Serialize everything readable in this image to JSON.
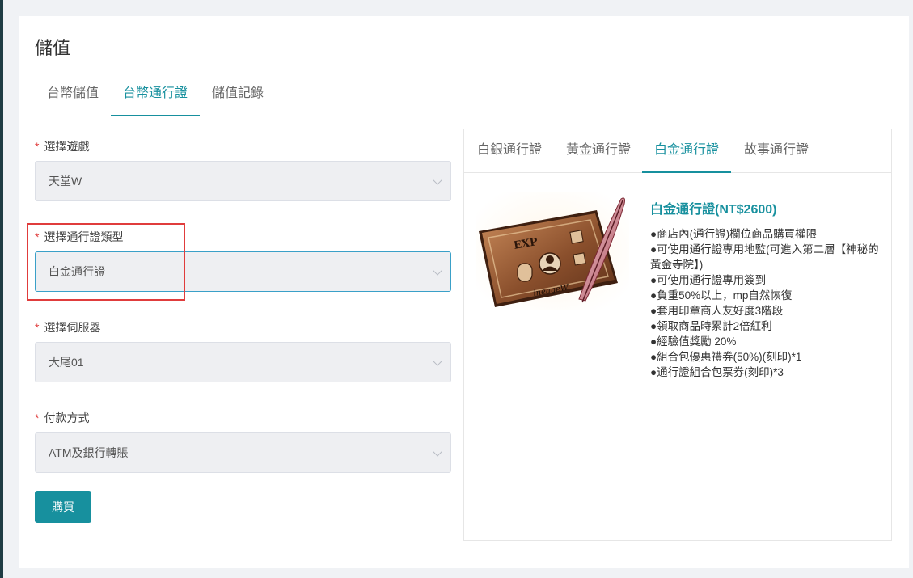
{
  "page": {
    "title": "儲值"
  },
  "main_tabs": [
    {
      "label": "台幣儲值",
      "active": false
    },
    {
      "label": "台幣通行證",
      "active": true
    },
    {
      "label": "儲值記錄",
      "active": false
    }
  ],
  "form": {
    "required_mark": "*",
    "game": {
      "label": "選擇遊戲",
      "value": "天堂W"
    },
    "pass_type": {
      "label": "選擇通行證類型",
      "value": "白金通行證"
    },
    "server": {
      "label": "選擇伺服器",
      "value": "大尾01"
    },
    "payment": {
      "label": "付款方式",
      "value": "ATM及銀行轉賬"
    },
    "buy_label": "購買"
  },
  "pass_tabs": [
    {
      "label": "白銀通行證",
      "active": false
    },
    {
      "label": "黃金通行證",
      "active": false
    },
    {
      "label": "白金通行證",
      "active": true
    },
    {
      "label": "故事通行證",
      "active": false
    }
  ],
  "pass_detail": {
    "name": "白金通行證(NT$2600)",
    "image_icon": "platinum-pass-scroll-icon",
    "perks": [
      "商店內(通行證)欄位商品購買權限",
      "可使用通行證專用地監(可進入第二層【神秘的黃金寺院】)",
      "可使用通行證專用簽到",
      "負重50%以上，mp自然恢復",
      "套用印章商人友好度3階段",
      "領取商品時累計2倍紅利",
      "經驗值獎勵 20%",
      "組合包優惠禮券(50%)(刻印)*1",
      "通行證組合包票券(刻印)*3"
    ]
  },
  "colors": {
    "accent": "#17909e",
    "required": "#e03c3c",
    "highlight": "#e03c3c"
  }
}
